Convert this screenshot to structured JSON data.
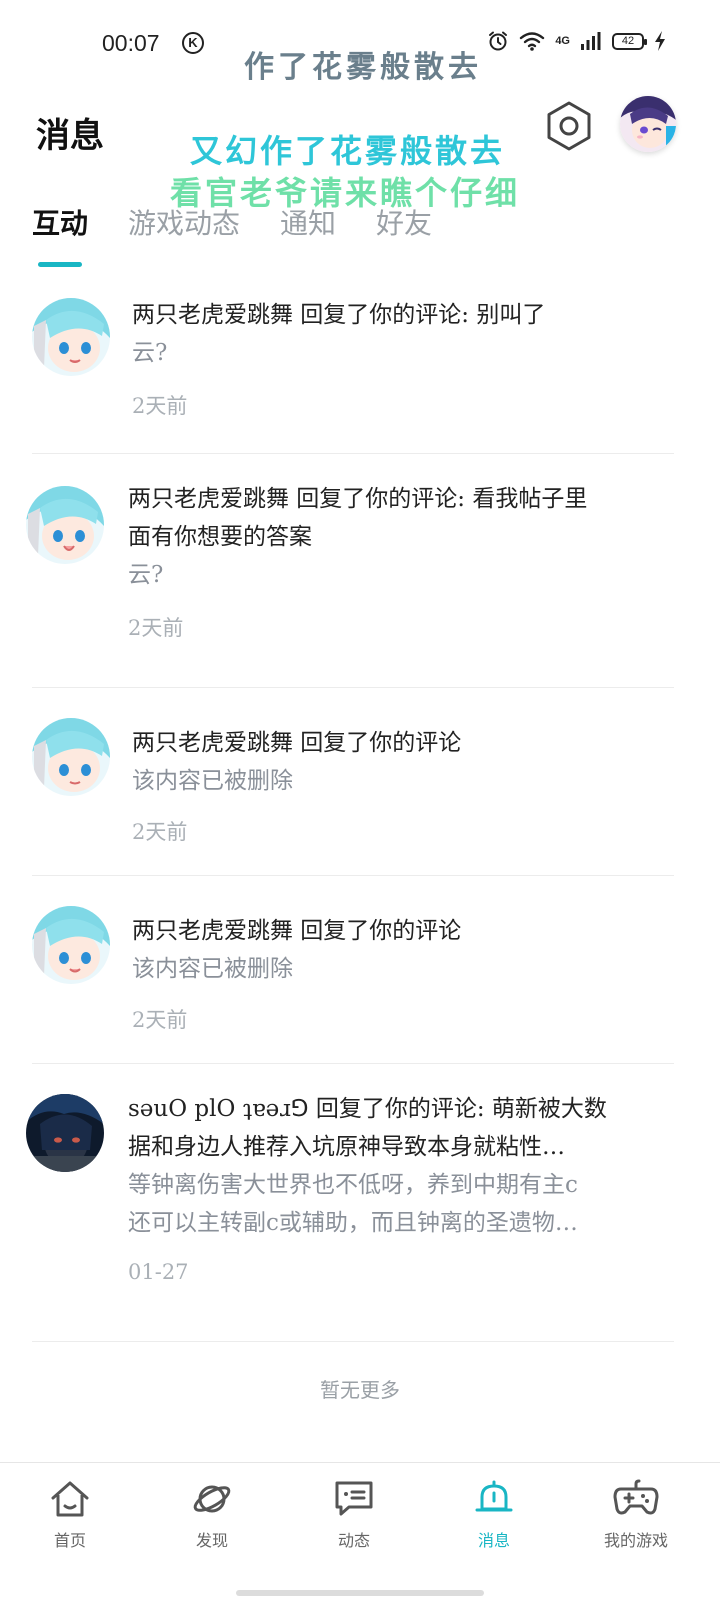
{
  "status_bar": {
    "time": "00:07",
    "k_badge": "K",
    "banner_text": "作了花雾般散去",
    "network": "4G",
    "battery": "42"
  },
  "header": {
    "title": "消息",
    "overlay_line_1": "又幻作了花雾般散去",
    "overlay_line_2": "看官老爷请来瞧个仔细"
  },
  "tabs": [
    {
      "label": "互动",
      "active": true
    },
    {
      "label": "游戏动态",
      "active": false
    },
    {
      "label": "通知",
      "active": false
    },
    {
      "label": "好友",
      "active": false
    }
  ],
  "messages": [
    {
      "avatar": "anime-girl-blue-hair",
      "lines": [
        "两只老虎爱跳舞 回复了你的评论: 别叫了",
        "云?"
      ],
      "time": "2天前"
    },
    {
      "avatar": "anime-girl-blue-hair",
      "lines": [
        "两只老虎爱跳舞 回复了你的评论: 看我帖子里",
        "面有你想要的答案",
        "云?"
      ],
      "time": "2天前"
    },
    {
      "avatar": "anime-girl-blue-hair",
      "lines": [
        "两只老虎爱跳舞 回复了你的评论",
        "该内容已被删除"
      ],
      "time": "2天前"
    },
    {
      "avatar": "anime-girl-blue-hair",
      "lines": [
        "两只老虎爱跳舞 回复了你的评论",
        "该内容已被删除"
      ],
      "time": "2天前"
    },
    {
      "avatar": "dark-hair-character",
      "lines": [
        "səuO plO ʇɐəɹ⅁ 回复了你的评论: 萌新被大数",
        "据和身边人推荐入坑原神导致本身就粘性…",
        "等钟离伤害大世界也不低呀，养到中期有主c",
        "还可以主转副c或辅助，而且钟离的圣遗物…"
      ],
      "time": "01-27"
    }
  ],
  "no_more_text": "暂无更多",
  "bottom_nav": [
    {
      "label": "首页",
      "icon": "home-icon"
    },
    {
      "label": "发现",
      "icon": "planet-icon"
    },
    {
      "label": "动态",
      "icon": "chat-icon"
    },
    {
      "label": "消息",
      "icon": "bell-icon",
      "active": true
    },
    {
      "label": "我的游戏",
      "icon": "gamepad-icon"
    }
  ],
  "colors": {
    "accent": "#19b6c4",
    "text_primary": "#222222",
    "text_secondary": "#8a9099",
    "text_time": "#aab0b6"
  }
}
